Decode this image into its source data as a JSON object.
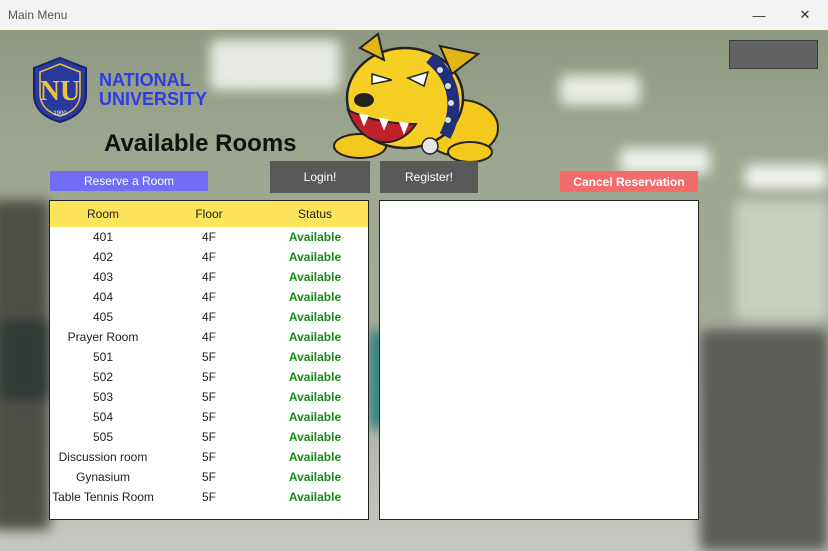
{
  "window": {
    "title": "Main Menu",
    "minimize_glyph": "—",
    "close_glyph": "✕"
  },
  "brand": {
    "line1": "NATIONAL",
    "line2": "UNIVERSITY",
    "shield_year": "1900",
    "shield_letters": "NU",
    "color": "#2b3ee0"
  },
  "heading": "Available Rooms",
  "buttons": {
    "reserve": "Reserve a Room",
    "login": "Login!",
    "register": "Register!",
    "cancel": "Cancel Reservation"
  },
  "table": {
    "headers": [
      "Room",
      "Floor",
      "Status"
    ],
    "rows": [
      [
        "401",
        "4F",
        "Available"
      ],
      [
        "402",
        "4F",
        "Available"
      ],
      [
        "403",
        "4F",
        "Available"
      ],
      [
        "404",
        "4F",
        "Available"
      ],
      [
        "405",
        "4F",
        "Available"
      ],
      [
        "Prayer Room",
        "4F",
        "Available"
      ],
      [
        "501",
        "5F",
        "Available"
      ],
      [
        "502",
        "5F",
        "Available"
      ],
      [
        "503",
        "5F",
        "Available"
      ],
      [
        "504",
        "5F",
        "Available"
      ],
      [
        "505",
        "5F",
        "Available"
      ],
      [
        "Discussion room",
        "5F",
        "Available"
      ],
      [
        "Gynasium",
        "5F",
        "Available"
      ],
      [
        "Table Tennis Room",
        "5F",
        "Available"
      ]
    ]
  },
  "colors": {
    "header_bg": "#fde45a",
    "status_green": "#178a17",
    "reserve_btn": "#6f6ef4",
    "cancel_btn": "#f46b6b",
    "dark_btn": "#595959"
  }
}
